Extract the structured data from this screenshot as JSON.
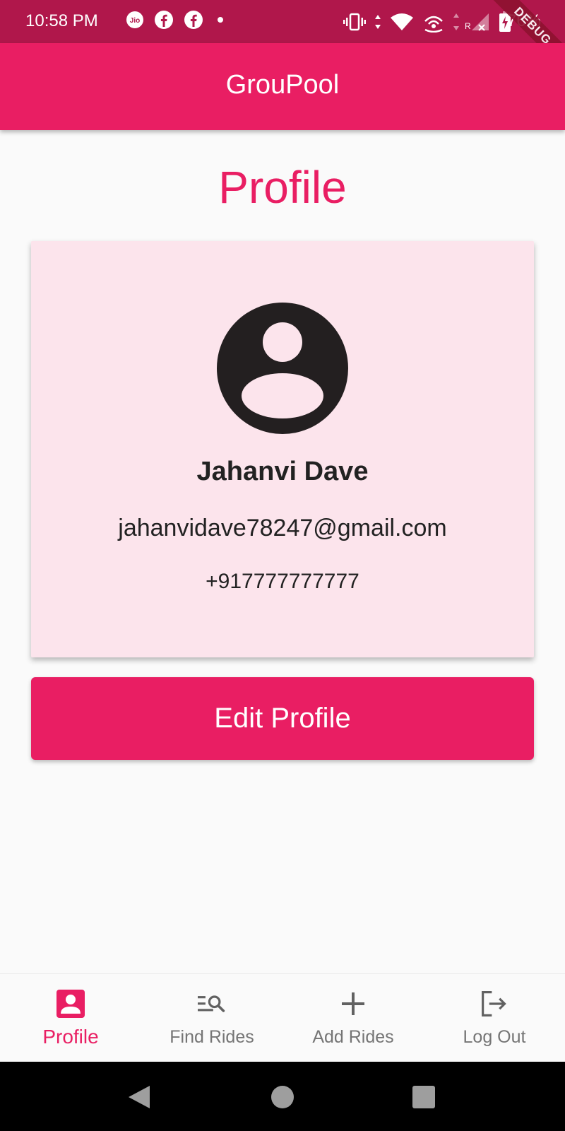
{
  "status_bar": {
    "time": "10:58 PM",
    "carrier_badge": "Jio",
    "battery_percent": "76%",
    "debug_label": "DEBUG",
    "icons": [
      "jio-icon",
      "facebook-icon",
      "facebook-icon",
      "dot-icon",
      "vibrate-icon",
      "wifi-icon",
      "hotspot-icon",
      "signal-icon",
      "battery-charging-icon"
    ]
  },
  "app_bar": {
    "title": "GrouPool"
  },
  "page": {
    "title": "Profile"
  },
  "profile": {
    "name": "Jahanvi Dave",
    "email": "jahanvidave78247@gmail.com",
    "phone": "+917777777777"
  },
  "actions": {
    "edit_label": "Edit Profile"
  },
  "bottom_nav": {
    "items": [
      {
        "label": "Profile",
        "icon": "account-box-icon",
        "active": true
      },
      {
        "label": "Find Rides",
        "icon": "manage-search-icon",
        "active": false
      },
      {
        "label": "Add Rides",
        "icon": "add-icon",
        "active": false
      },
      {
        "label": "Log Out",
        "icon": "logout-icon",
        "active": false
      }
    ]
  },
  "colors": {
    "primary": "#e91e63",
    "status_bar": "#b0174b",
    "card_background": "#fce4ec",
    "inactive_nav": "#757575"
  }
}
